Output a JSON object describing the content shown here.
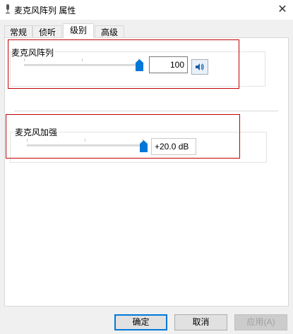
{
  "window": {
    "title": "麦克风阵列 属性",
    "close_symbol": "✕"
  },
  "tabs": [
    {
      "label": "常规",
      "active": false
    },
    {
      "label": "侦听",
      "active": false
    },
    {
      "label": "级别",
      "active": true
    },
    {
      "label": "高级",
      "active": false
    }
  ],
  "levels": {
    "mic_array": {
      "label": "麦克风阵列",
      "value": "100",
      "slider_fraction": 1.0
    },
    "mic_boost": {
      "label": "麦克风加强",
      "value": "+20.0 dB",
      "slider_fraction": 1.0
    }
  },
  "buttons": {
    "ok": "确定",
    "cancel": "取消",
    "apply": "应用(A)"
  },
  "colors": {
    "accent": "#0078d7",
    "highlight_frame": "#c00000"
  }
}
